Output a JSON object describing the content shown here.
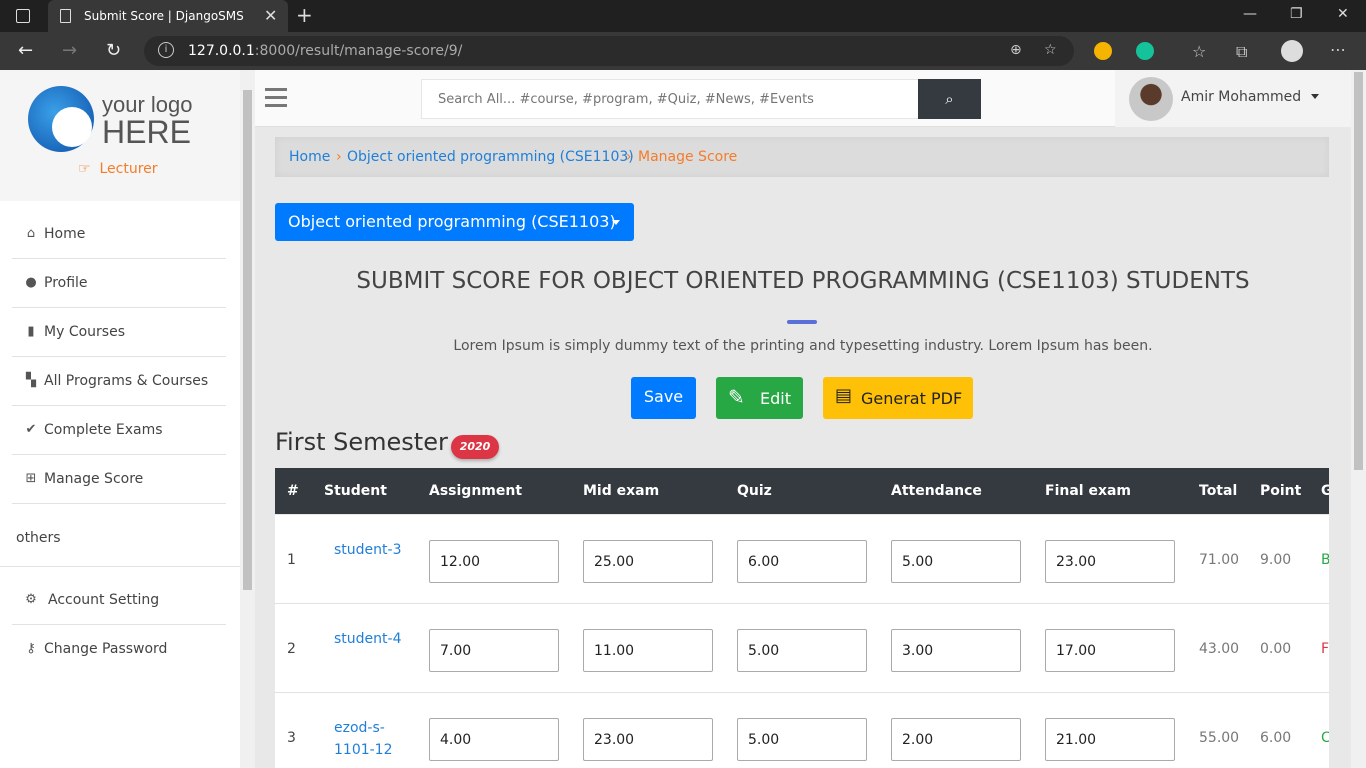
{
  "browser": {
    "tab_title": "Submit Score | DjangoSMS",
    "url_host": "127.0.0.1",
    "url_rest": ":8000/result/manage-score/9/"
  },
  "sidebar": {
    "logo_line1": "your logo",
    "logo_line2": "HERE",
    "role": "Lecturer",
    "items": [
      {
        "label": "Home",
        "icon": "home-icon"
      },
      {
        "label": "Profile",
        "icon": "user-icon"
      },
      {
        "label": "My Courses",
        "icon": "book-icon"
      },
      {
        "label": "All Programs & Courses",
        "icon": "open-book-icon"
      },
      {
        "label": "Complete Exams",
        "icon": "check-double-icon"
      },
      {
        "label": "Manage Score",
        "icon": "table-icon"
      }
    ],
    "others_label": "others",
    "bottom_items": [
      {
        "label": "Account Setting",
        "icon": "cogs-icon"
      },
      {
        "label": "Change Password",
        "icon": "key-icon"
      }
    ]
  },
  "topbar": {
    "search_placeholder": "Search All... #course, #program, #Quiz, #News, #Events",
    "user_name": "Amir Mohammed"
  },
  "breadcrumb": {
    "home": "Home",
    "course": "Object oriented programming (CSE1103)",
    "current": "Manage Score"
  },
  "main": {
    "course_dropdown": "Object oriented programming (CSE1103)",
    "heading": "SUBMIT SCORE FOR OBJECT ORIENTED PROGRAMMING (CSE1103) STUDENTS",
    "lead": "Lorem Ipsum is simply dummy text of the printing and typesetting industry. Lorem Ipsum has been.",
    "save_label": "Save",
    "edit_label": "Edit",
    "pdf_label": "Generat PDF",
    "semester_title": "First Semester",
    "semester_badge": "2020"
  },
  "table": {
    "headers": [
      "#",
      "Student",
      "Assignment",
      "Mid exam",
      "Quiz",
      "Attendance",
      "Final exam",
      "Total",
      "Point",
      "Grade"
    ],
    "rows": [
      {
        "num": "1",
        "student": "student-3",
        "assignment": "12.00",
        "mid": "25.00",
        "quiz": "6.00",
        "attendance": "5.00",
        "final": "23.00",
        "total": "71.00",
        "point": "9.00",
        "grade": "B+",
        "grade_color": "#28a745"
      },
      {
        "num": "2",
        "student": "student-4",
        "assignment": "7.00",
        "mid": "11.00",
        "quiz": "5.00",
        "attendance": "3.00",
        "final": "17.00",
        "total": "43.00",
        "point": "0.00",
        "grade": "F",
        "grade_color": "#dc3545"
      },
      {
        "num": "3",
        "student": "ezod-s-1101-12",
        "assignment": "4.00",
        "mid": "23.00",
        "quiz": "5.00",
        "attendance": "2.00",
        "final": "21.00",
        "total": "55.00",
        "point": "6.00",
        "grade": "C+",
        "grade_color": "#28a745"
      }
    ]
  }
}
